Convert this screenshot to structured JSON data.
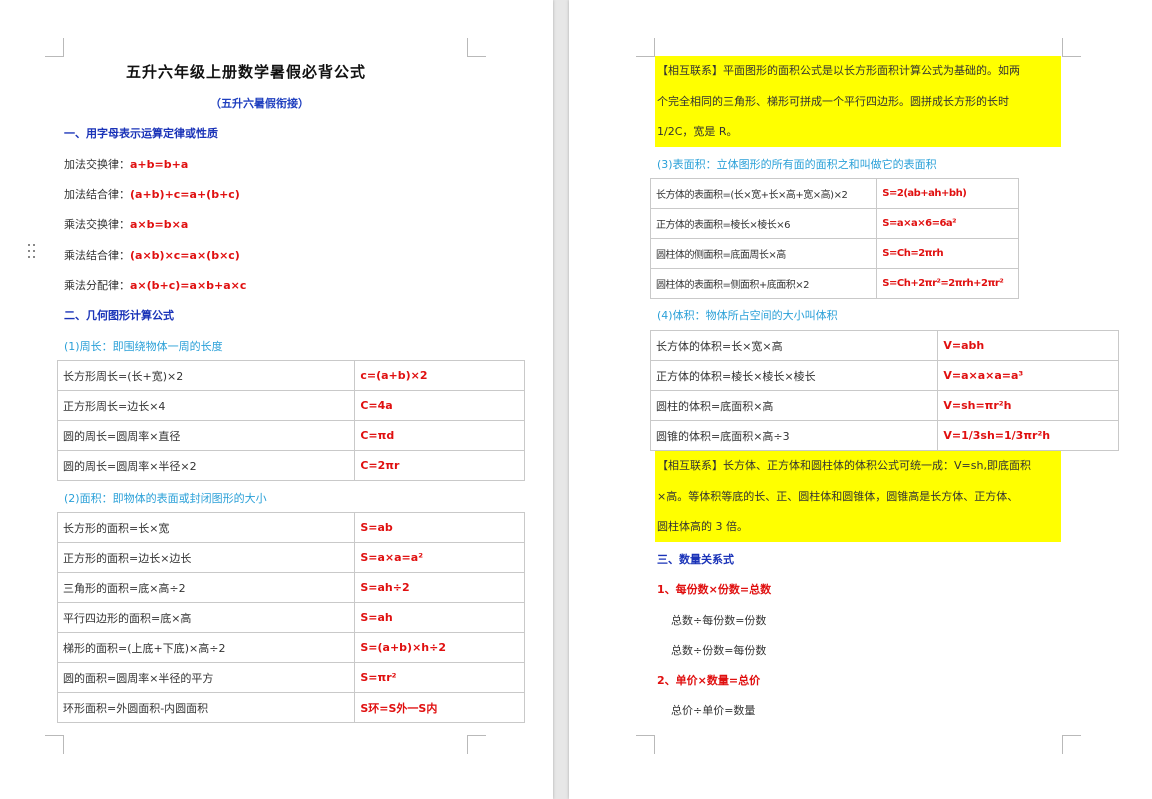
{
  "left": {
    "title": "五升六年级上册数学暑假必背公式",
    "subtitle": "（五升六暑假衔接）",
    "sec1_heading": "一、用字母表示运算定律或性质",
    "laws": [
      {
        "label": "加法交换律：",
        "formula": "a+b=b+a"
      },
      {
        "label": "加法结合律：",
        "formula": "(a+b)+c=a+(b+c)"
      },
      {
        "label": "乘法交换律：",
        "formula": "a×b=b×a"
      },
      {
        "label": "乘法结合律：",
        "formula": "(a×b)×c=a×(b×c)"
      },
      {
        "label": "乘法分配律：",
        "formula": "a×(b+c)=a×b+a×c"
      }
    ],
    "sec2_heading": "二、几何图形计算公式",
    "perimeter_heading": "(1)周长：即围绕物体一周的长度",
    "perimeter_rows": [
      {
        "text": "长方形周长=(长+宽)×2",
        "formula": "c=(a+b)×2"
      },
      {
        "text": "正方形周长=边长×4",
        "formula": "C=4a"
      },
      {
        "text": "圆的周长=圆周率×直径",
        "formula": "C=πd"
      },
      {
        "text": "圆的周长=圆周率×半径×2",
        "formula": "C=2πr"
      }
    ],
    "area_heading": "(2)面积：即物体的表面或封闭图形的大小",
    "area_rows": [
      {
        "text": "长方形的面积=长×宽",
        "formula": "S=ab"
      },
      {
        "text": "正方形的面积=边长×边长",
        "formula": "S=a×a=a²"
      },
      {
        "text": "三角形的面积=底×高÷2",
        "formula": "S=ah÷2"
      },
      {
        "text": "平行四边形的面积=底×高",
        "formula": "S=ah"
      },
      {
        "text": "梯形的面积=(上底+下底)×高÷2",
        "formula": "S=(a+b)×h÷2"
      },
      {
        "text": "圆的面积=圆周率×半径的平方",
        "formula": "S=πr²"
      },
      {
        "text": "环形面积=外圆面积-内圆面积",
        "formula": "S环=S外一S内"
      }
    ]
  },
  "right": {
    "connection1_lines": [
      "【相互联系】平面图形的面积公式是以长方形面积计算公式为基础的。如两",
      "个完全相同的三角形、梯形可拼成一个平行四边形。圆拼成长方形的长时",
      "1/2C，宽是 R。"
    ],
    "surface_heading": "(3)表面积：立体图形的所有面的面积之和叫做它的表面积",
    "surface_rows": [
      {
        "text": "长方体的表面积=(长×宽+长×高+宽×高)×2",
        "formula": "S=2(ab+ah+bh)"
      },
      {
        "text": "正方体的表面积=棱长×棱长×6",
        "formula": "S=a×a×6=6a²"
      },
      {
        "text": "圆柱体的侧面积=底面周长×高",
        "formula": "S=Ch=2πrh"
      },
      {
        "text": "圆柱体的表面积=侧面积+底面积×2",
        "formula": "S=Ch+2πr²=2πrh+2πr²"
      }
    ],
    "volume_heading": "(4)体积：物体所占空间的大小叫体积",
    "volume_rows": [
      {
        "text": "长方体的体积=长×宽×高",
        "formula": "V=abh"
      },
      {
        "text": "正方体的体积=棱长×棱长×棱长",
        "formula": "V=a×a×a=a³"
      },
      {
        "text": "圆柱的体积=底面积×高",
        "formula": "V=sh=πr²h"
      },
      {
        "text": "圆锥的体积=底面积×高÷3",
        "formula": "V=1/3sh=1/3πr²h"
      }
    ],
    "connection2_lines": [
      "【相互联系】长方体、正方体和圆柱体的体积公式可统一成：V=sh,即底面积",
      "×高。等体积等底的长、正、圆柱体和圆锥体，圆锥高是长方体、正方体、",
      "圆柱体高的 3 倍。"
    ],
    "sec3_heading": "三、数量关系式",
    "relation1_heading": "1、每份数×份数=总数",
    "relation1_lines": [
      "总数÷每份数=份数",
      "总数÷份数=每份数"
    ],
    "relation2_heading": "2、单价×数量=总价",
    "relation2_lines": [
      "总价÷单价=数量"
    ]
  },
  "colors": {
    "formula_red": "#e01010",
    "heading_blue": "#1a33b8",
    "heading_cyan": "#2aa0d8",
    "highlight_yellow": "#ffff00"
  }
}
